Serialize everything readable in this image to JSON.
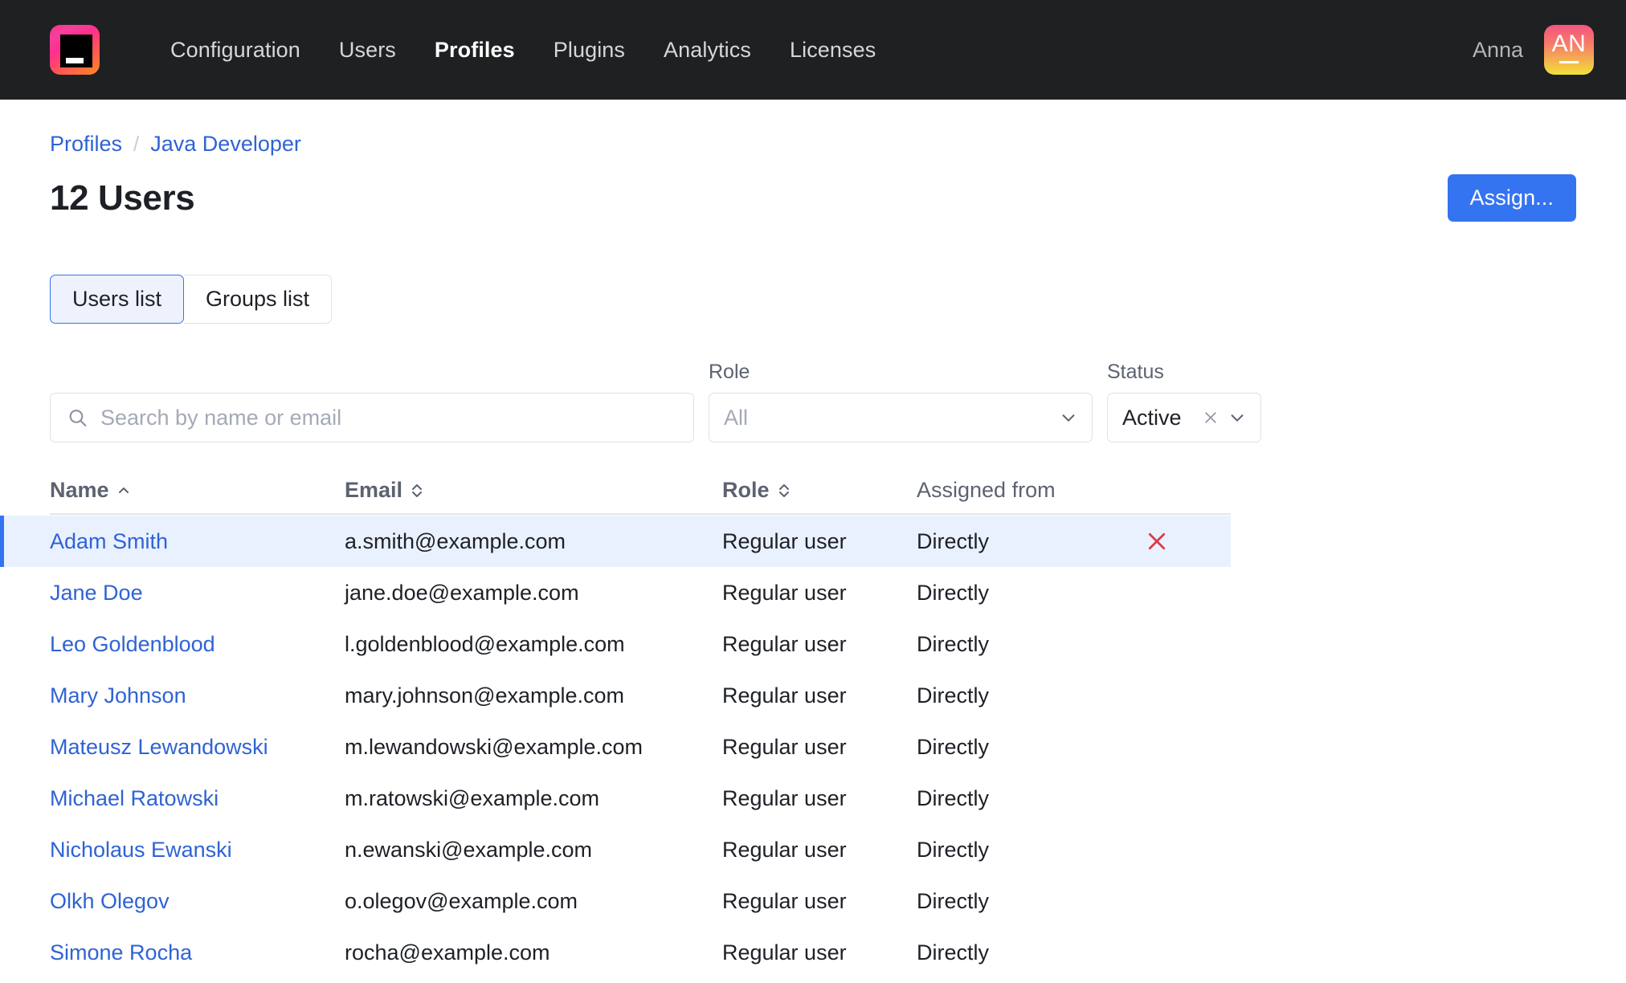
{
  "header": {
    "logo_icon": "product-logo-icon",
    "nav_items": [
      {
        "label": "Configuration",
        "active": false
      },
      {
        "label": "Users",
        "active": false
      },
      {
        "label": "Profiles",
        "active": true
      },
      {
        "label": "Plugins",
        "active": false
      },
      {
        "label": "Analytics",
        "active": false
      },
      {
        "label": "Licenses",
        "active": false
      }
    ],
    "user_name": "Anna",
    "avatar_initials": "AN",
    "bg_color": "#1e2022"
  },
  "breadcrumb": {
    "parent": "Profiles",
    "separator": "/",
    "current": "Java Developer"
  },
  "page": {
    "title": "12 Users",
    "assign_label": "Assign..."
  },
  "tabs": [
    {
      "label": "Users list",
      "active": true
    },
    {
      "label": "Groups list",
      "active": false
    }
  ],
  "filters": {
    "search": {
      "value": "",
      "placeholder": "Search by name or email",
      "icon": "search-icon"
    },
    "role": {
      "label": "Role",
      "value": "All",
      "is_placeholder": true
    },
    "status": {
      "label": "Status",
      "value": "Active",
      "is_placeholder": false,
      "clearable": true
    }
  },
  "table": {
    "columns": [
      {
        "label": "Name",
        "sort": "asc"
      },
      {
        "label": "Email",
        "sort": "none"
      },
      {
        "label": "Role",
        "sort": "none"
      },
      {
        "label": "Assigned from",
        "sort": null
      }
    ],
    "rows": [
      {
        "name": "Adam Smith",
        "email": "a.smith@example.com",
        "role": "Regular user",
        "assigned_from": "Directly",
        "highlighted": true,
        "removable": true
      },
      {
        "name": "Jane Doe",
        "email": "jane.doe@example.com",
        "role": "Regular user",
        "assigned_from": "Directly",
        "highlighted": false,
        "removable": false
      },
      {
        "name": "Leo Goldenblood",
        "email": "l.goldenblood@example.com",
        "role": "Regular user",
        "assigned_from": "Directly",
        "highlighted": false,
        "removable": false
      },
      {
        "name": "Mary Johnson",
        "email": "mary.johnson@example.com",
        "role": "Regular user",
        "assigned_from": "Directly",
        "highlighted": false,
        "removable": false
      },
      {
        "name": "Mateusz Lewandowski",
        "email": "m.lewandowski@example.com",
        "role": "Regular user",
        "assigned_from": "Directly",
        "highlighted": false,
        "removable": false
      },
      {
        "name": "Michael Ratowski",
        "email": "m.ratowski@example.com",
        "role": "Regular user",
        "assigned_from": "Directly",
        "highlighted": false,
        "removable": false
      },
      {
        "name": "Nicholaus Ewanski",
        "email": "n.ewanski@example.com",
        "role": "Regular user",
        "assigned_from": "Directly",
        "highlighted": false,
        "removable": false
      },
      {
        "name": "Olkh Olegov",
        "email": "o.olegov@example.com",
        "role": "Regular user",
        "assigned_from": "Directly",
        "highlighted": false,
        "removable": false
      },
      {
        "name": "Simone Rocha",
        "email": "rocha@example.com",
        "role": "Regular user",
        "assigned_from": "Directly",
        "highlighted": false,
        "removable": false
      }
    ]
  },
  "colors": {
    "accent_blue": "#3574f0",
    "link_blue": "#2f63d4",
    "danger_red": "#d93b4a",
    "header_bg": "#1e2022",
    "row_highlight": "#eaf1fe"
  }
}
